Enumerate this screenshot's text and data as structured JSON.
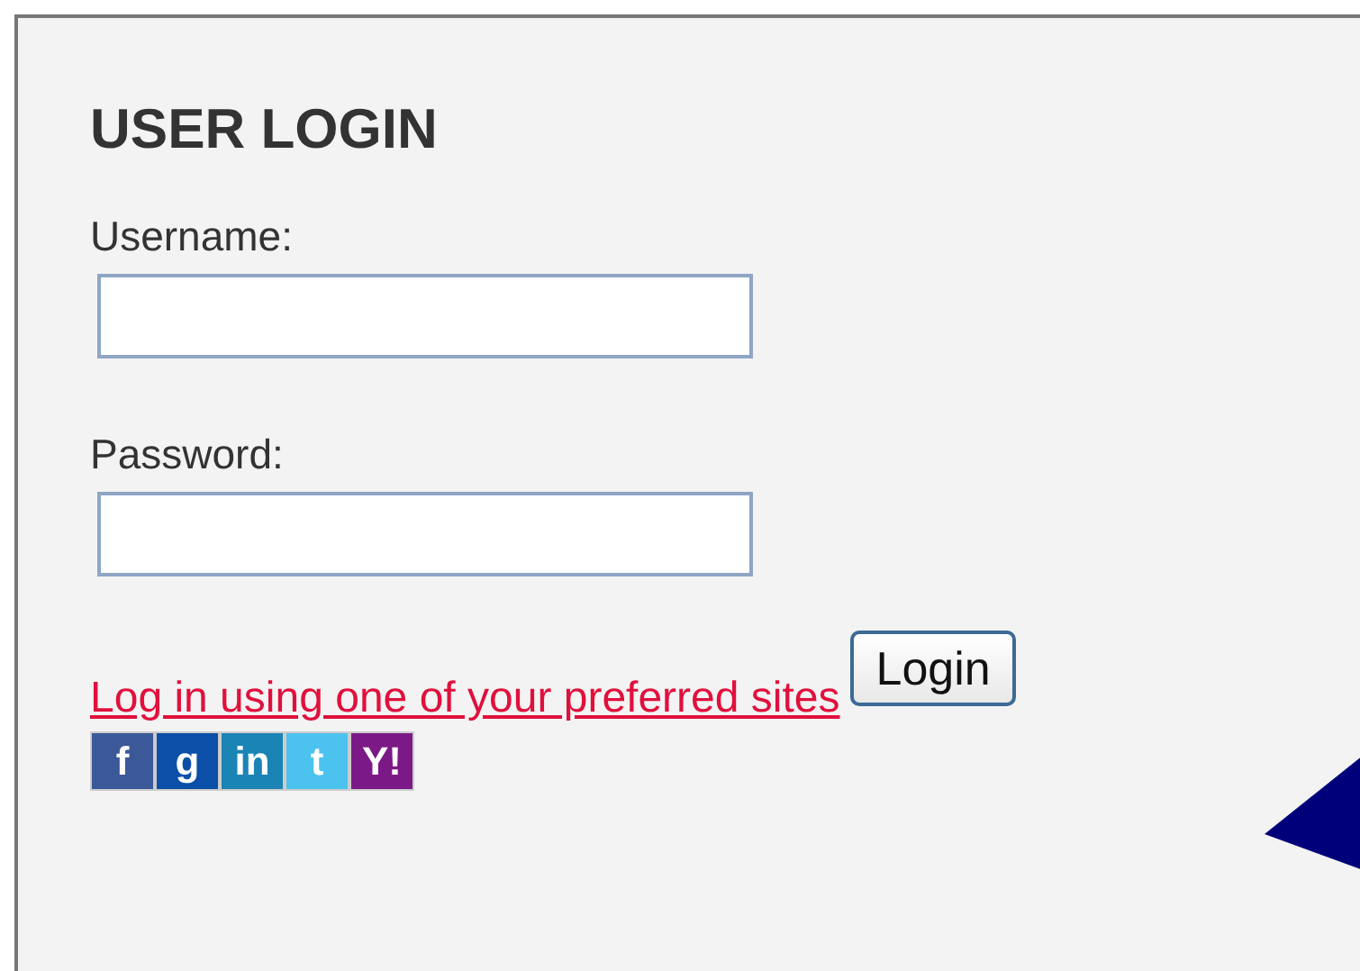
{
  "title": "USER LOGIN",
  "fields": [
    {
      "label": "Username:"
    },
    {
      "label": "Password:"
    }
  ],
  "social_link": "Log in using one of your preferred sites",
  "login_button": "Login",
  "social_icons": [
    {
      "glyph": "f",
      "color": "#3b5998"
    },
    {
      "glyph": "g",
      "color": "#0b4fa8"
    },
    {
      "glyph": "in",
      "color": "#1a84b5"
    },
    {
      "glyph": "t",
      "color": "#4cc2ee"
    },
    {
      "glyph": "Y!",
      "color": "#7b1a86"
    }
  ]
}
